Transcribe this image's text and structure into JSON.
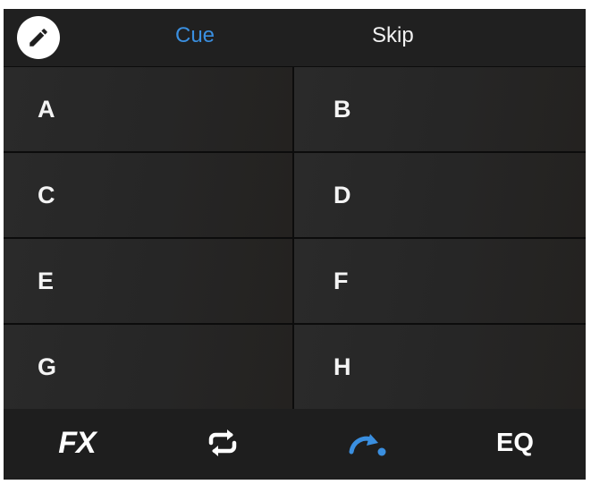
{
  "header": {
    "edit_icon": "pencil-icon",
    "tabs": [
      {
        "label": "Cue",
        "active": true
      },
      {
        "label": "Skip",
        "active": false
      }
    ]
  },
  "pads": [
    {
      "label": "A"
    },
    {
      "label": "B"
    },
    {
      "label": "C"
    },
    {
      "label": "D"
    },
    {
      "label": "E"
    },
    {
      "label": "F"
    },
    {
      "label": "G"
    },
    {
      "label": "H"
    }
  ],
  "toolbar": {
    "fx_label": "FX",
    "loop_icon": "loop-icon",
    "jump_icon": "cue-jump-icon",
    "eq_label": "EQ"
  },
  "colors": {
    "accent": "#3a8fe0",
    "background": "#1f1f1f",
    "text": "#f4f4f4"
  }
}
